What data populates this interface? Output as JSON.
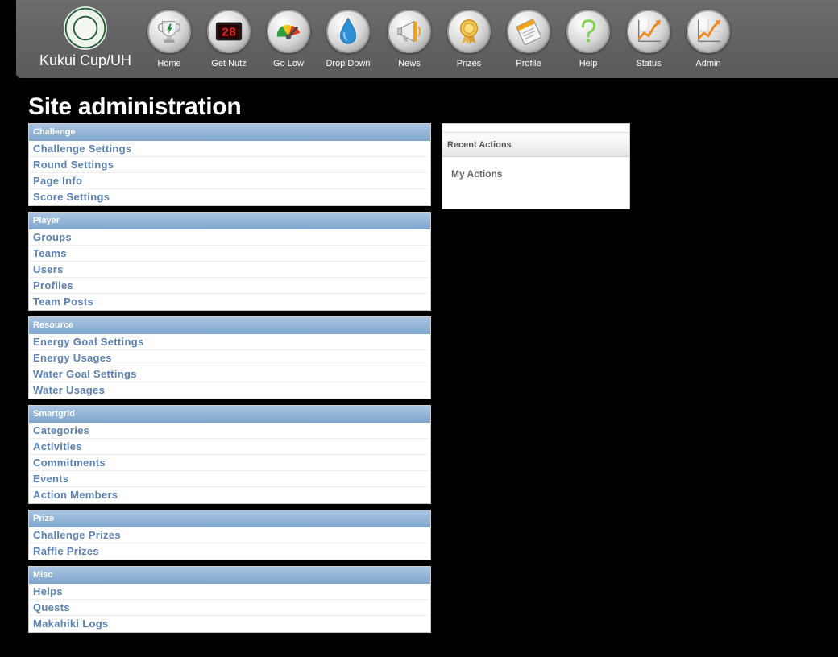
{
  "brand": {
    "name": "Kukui Cup/UH",
    "logo_icon": "university-seal-icon"
  },
  "nav": [
    {
      "label": "Home",
      "icon": "trophy-icon"
    },
    {
      "label": "Get Nutz",
      "icon": "scoreboard-icon",
      "display": "28"
    },
    {
      "label": "Go Low",
      "icon": "gauge-icon"
    },
    {
      "label": "Drop Down",
      "icon": "water-drop-icon"
    },
    {
      "label": "News",
      "icon": "megaphone-icon"
    },
    {
      "label": "Prizes",
      "icon": "medal-icon"
    },
    {
      "label": "Profile",
      "icon": "id-card-icon"
    },
    {
      "label": "Help",
      "icon": "question-mark-icon"
    },
    {
      "label": "Status",
      "icon": "trend-chart-icon"
    },
    {
      "label": "Admin",
      "icon": "trend-chart-icon"
    }
  ],
  "page_title": "Site administration",
  "modules": [
    {
      "title": "Challenge",
      "items": [
        "Challenge Settings",
        "Round Settings",
        "Page Info",
        "Score Settings"
      ]
    },
    {
      "title": "Player",
      "items": [
        "Groups",
        "Teams",
        "Users",
        "Profiles",
        "Team Posts"
      ]
    },
    {
      "title": "Resource",
      "items": [
        "Energy Goal Settings",
        "Energy Usages",
        "Water Goal Settings",
        "Water Usages"
      ]
    },
    {
      "title": "Smartgrid",
      "items": [
        "Categories",
        "Activities",
        "Commitments",
        "Events",
        "Action Members"
      ]
    },
    {
      "title": "Prize",
      "items": [
        "Challenge Prizes",
        "Raffle Prizes"
      ]
    },
    {
      "title": "Misc",
      "items": [
        "Helps",
        "Quests",
        "Makahiki Logs"
      ]
    }
  ],
  "recent_actions": {
    "title": "Recent Actions",
    "subtitle": "My Actions"
  },
  "colors": {
    "background": "#000000",
    "navbar": "#616161",
    "module_header": "#7fa6cd",
    "link": "#5b80b2"
  }
}
